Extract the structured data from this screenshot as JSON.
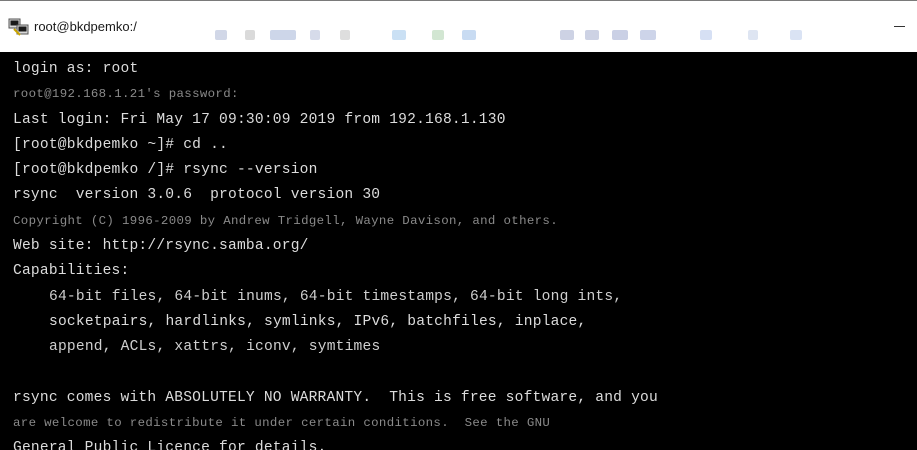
{
  "window": {
    "title": "root@bkdpemko:/"
  },
  "terminal": {
    "lines": [
      {
        "text": "login as: root",
        "style": "bright",
        "indent": false
      },
      {
        "text": "root@192.168.1.21's password:",
        "style": "dim",
        "indent": false
      },
      {
        "text": "Last login: Fri May 17 09:30:09 2019 from 192.168.1.130",
        "style": "bright",
        "indent": false
      },
      {
        "text": "[root@bkdpemko ~]# cd ..",
        "style": "bright",
        "indent": false
      },
      {
        "text": "[root@bkdpemko /]# rsync --version",
        "style": "bright",
        "indent": false
      },
      {
        "text": "rsync  version 3.0.6  protocol version 30",
        "style": "bright",
        "indent": false
      },
      {
        "text": "Copyright (C) 1996-2009 by Andrew Tridgell, Wayne Davison, and others.",
        "style": "dim",
        "indent": false
      },
      {
        "text": "Web site: http://rsync.samba.org/",
        "style": "bright",
        "indent": false
      },
      {
        "text": "Capabilities:",
        "style": "bright",
        "indent": false
      },
      {
        "text": "64-bit files, 64-bit inums, 64-bit timestamps, 64-bit long ints,",
        "style": "normal",
        "indent": true
      },
      {
        "text": "socketpairs, hardlinks, symlinks, IPv6, batchfiles, inplace,",
        "style": "bright",
        "indent": true
      },
      {
        "text": "append, ACLs, xattrs, iconv, symtimes",
        "style": "normal",
        "indent": true
      },
      {
        "text": "",
        "style": "normal",
        "indent": false
      },
      {
        "text": "rsync comes with ABSOLUTELY NO WARRANTY.  This is free software, and you",
        "style": "bright",
        "indent": false
      },
      {
        "text": "are welcome to redistribute it under certain conditions.  See the GNU",
        "style": "dim",
        "indent": false
      },
      {
        "text": "General Public Licence for details.",
        "style": "bright",
        "indent": false
      }
    ]
  }
}
